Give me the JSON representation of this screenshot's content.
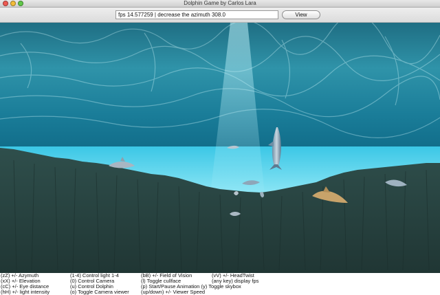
{
  "window": {
    "title": "Dolphin Game by Carlos Lara"
  },
  "toolbar": {
    "status": "fps 14.577259 | decrease the azimuth 308.0",
    "view_label": "View"
  },
  "scene": {
    "water_color": "#2a8fa6",
    "floor_color": "#2b4a48",
    "light_shaft_color": "#7fd8e8"
  },
  "help": {
    "col1": [
      "(zZ) +/-   Azymuth",
      "(xX) +/-   Elevation",
      "(cC) +/-   Eye distance",
      "(hH) +/-   light intensity"
    ],
    "col2": [
      "(1-4) Control light 1-4",
      "(0)  Control Camera",
      "(u)  Control Dolphin",
      "(o)  Toggle Camera viewer"
    ],
    "col3": [
      "(bB) +/-   Field of Vision",
      "(l)   Toggle cullface",
      "(p)  Start/Pause Animation  (y)  Toggle skybox",
      "(up/down)  +/-  Viewer Speed"
    ],
    "col4": [
      "(vV) +/-   HeadTwist",
      "(any key) display fps"
    ]
  }
}
